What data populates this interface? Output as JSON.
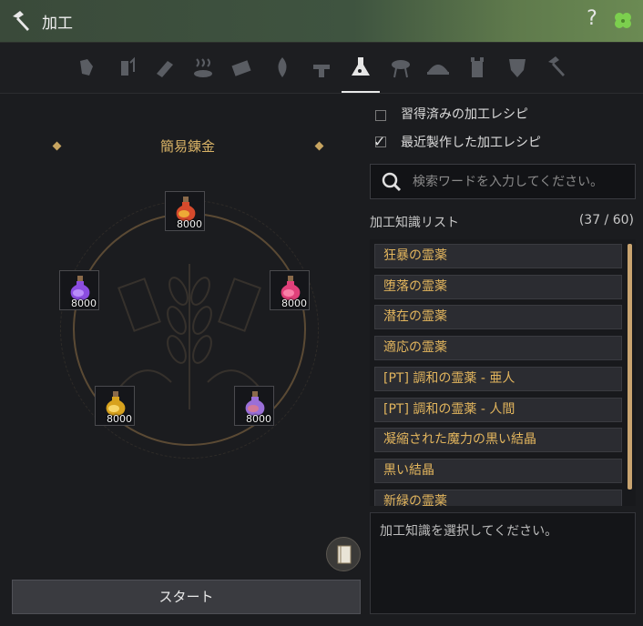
{
  "window": {
    "title": "加工",
    "help": "?"
  },
  "tabs": [
    {
      "name": "gathering-icon"
    },
    {
      "name": "heating-icon"
    },
    {
      "name": "chopping-icon"
    },
    {
      "name": "drying-icon"
    },
    {
      "name": "grinding-icon"
    },
    {
      "name": "filtering-icon"
    },
    {
      "name": "shaking-icon"
    },
    {
      "name": "alchemy-icon",
      "active": true
    },
    {
      "name": "grill-icon"
    },
    {
      "name": "cooking-icon"
    },
    {
      "name": "castle-icon"
    },
    {
      "name": "guild-shield-icon"
    },
    {
      "name": "hammer-icon"
    }
  ],
  "recipe": {
    "title": "簡易錬金",
    "slots": [
      {
        "item": "red-potion",
        "count": "8000",
        "color": "#d64a2c",
        "color2": "#f2c23a"
      },
      {
        "item": "purple-potion",
        "count": "8000",
        "color": "#8b4de0",
        "color2": "#c49bff"
      },
      {
        "item": "pink-potion",
        "count": "8000",
        "color": "#e0407a",
        "color2": "#ff8fb4"
      },
      {
        "item": "yellow-potion",
        "count": "8000",
        "color": "#d7a21e",
        "color2": "#ffe37a"
      },
      {
        "item": "violet-potion",
        "count": "8000",
        "color": "#9a6fd8",
        "color2": "#e07a8a"
      }
    ]
  },
  "start_button": "スタート",
  "filters": [
    {
      "label": "習得済みの加工レシピ",
      "checked": false
    },
    {
      "label": "最近製作した加工レシピ",
      "checked": true
    }
  ],
  "search": {
    "placeholder": "検索ワードを入力してください。"
  },
  "knowledge": {
    "title": "加工知識リスト",
    "count": "(37 / 60)",
    "items": [
      "狂暴の霊薬",
      "堕落の霊薬",
      "潜在の霊薬",
      "適応の霊薬",
      "[PT] 調和の霊薬 - 亜人",
      "[PT] 調和の霊薬 - 人間",
      "凝縮された魔力の黒い結晶",
      "黒い結晶",
      "新緑の霊薬"
    ]
  },
  "description": {
    "placeholder": "加工知識を選択してください。"
  },
  "colors": {
    "accent": "#e2b55d",
    "title_bar": "#3f5440",
    "scroll_thumb": "#c9a470"
  }
}
